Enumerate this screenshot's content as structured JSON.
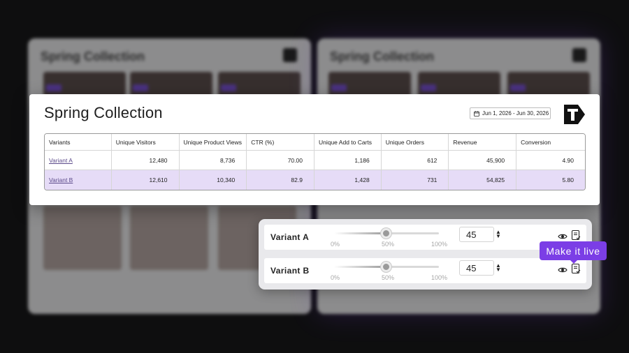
{
  "background": {
    "card_title": "Spring Collection"
  },
  "panel": {
    "title": "Spring Collection",
    "date_range": "Jun 1, 2026 - Jun 30, 2026"
  },
  "table": {
    "headers": [
      "Variants",
      "Unique Visitors",
      "Unique Product Views",
      "CTR (%)",
      "Unique Add to Carts",
      "Unique Orders",
      "Revenue",
      "Conversion"
    ],
    "rows": [
      {
        "variant": "Variant A",
        "visitors": "12,480",
        "views": "8,736",
        "ctr": "70.00",
        "adds": "1,186",
        "orders": "612",
        "revenue": "45,900",
        "conversion": "4.90"
      },
      {
        "variant": "Variant B",
        "visitors": "12,610",
        "views": "10,340",
        "ctr": "82.9",
        "adds": "1,428",
        "orders": "731",
        "revenue": "54,825",
        "conversion": "5.80"
      }
    ]
  },
  "sliders": {
    "ticks": [
      "0%",
      "50%",
      "100%"
    ],
    "rows": [
      {
        "label": "Variant A",
        "value": "45",
        "level_percent": 50
      },
      {
        "label": "Variant B",
        "value": "45",
        "level_percent": 50
      }
    ]
  },
  "tooltip": "Make it live",
  "colors": {
    "accent": "#7b3ee6",
    "highlight_row": "#e6dcf7"
  },
  "icons": [
    "calendar-icon",
    "brand-logo-icon",
    "eye-icon",
    "document-check-icon",
    "spinner-arrows-icon"
  ]
}
